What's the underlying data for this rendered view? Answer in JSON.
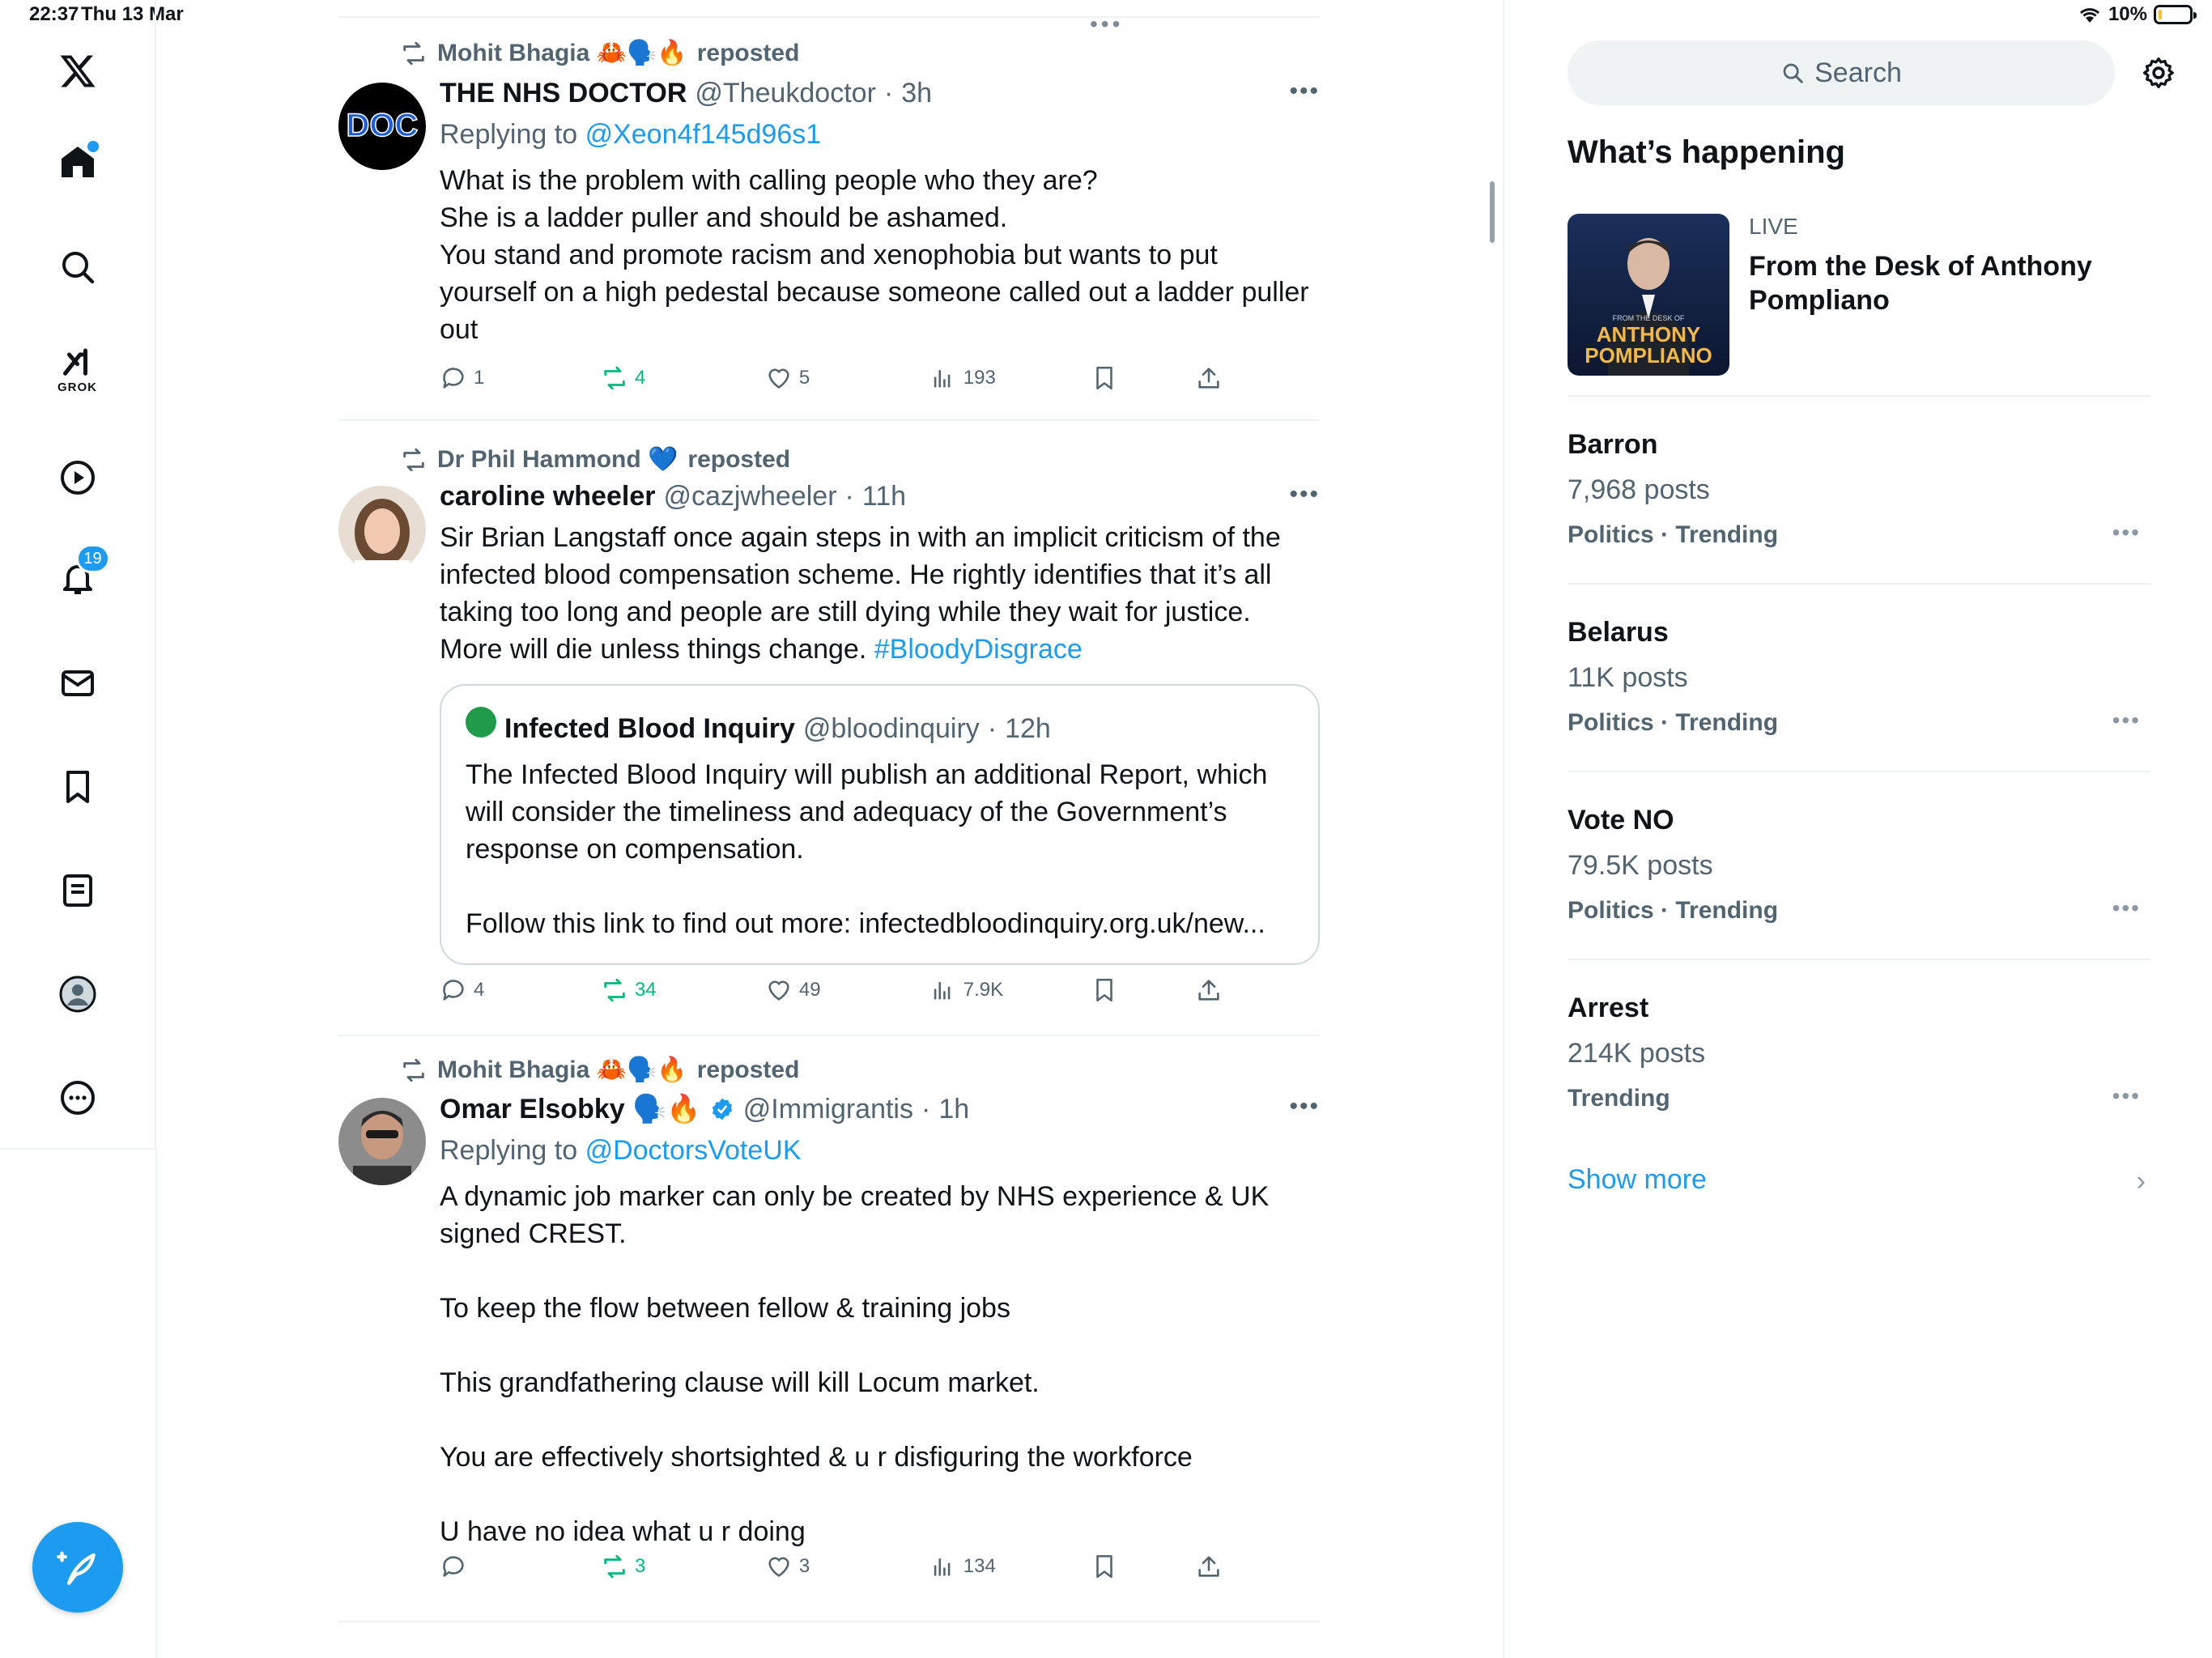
{
  "status_bar": {
    "time": "22:37",
    "date": "Thu 13 Mar",
    "battery": "10%",
    "battery_level": 0.1
  },
  "nav": {
    "grok_label": "GROK",
    "notifications_badge": "19",
    "items": [
      "home",
      "explore",
      "grok",
      "video",
      "notifications",
      "messages",
      "bookmarks",
      "lists",
      "profile",
      "more"
    ]
  },
  "tweets": [
    {
      "reposter": "Mohit Bhagia 🦀🗣️🔥",
      "repost_suffix": "reposted",
      "name": "THE NHS DOCTOR",
      "handle": "@Theukdoctor",
      "time": "3h",
      "replying_prefix": "Replying to",
      "replying_to": "@Xeon4f145d96s1",
      "text": "What is the problem with calling people who they are?\nShe is a ladder puller and should be ashamed.\nYou stand and promote racism and xenophobia but wants to put yourself on a high pedestal because someone called out a ladder puller out",
      "replies": "1",
      "reposts": "4",
      "likes": "5",
      "views": "193"
    },
    {
      "reposter": "Dr Phil Hammond 💙",
      "repost_suffix": "reposted",
      "name": "caroline wheeler",
      "handle": "@cazjwheeler",
      "time": "11h",
      "text": "Sir Brian Langstaff once again steps in with an implicit criticism of the infected blood compensation scheme. He rightly identifies that it’s all taking too long and people are still dying while they wait for justice. More will die unless things change.",
      "hashtag": "#BloodyDisgrace",
      "quote": {
        "name": "Infected Blood Inquiry",
        "handle": "@bloodinquiry",
        "time": "12h",
        "text": "The Infected Blood Inquiry will publish an additional Report, which will consider the timeliness and adequacy of the Government’s response on compensation.\n\nFollow this link to find out more: infectedbloodinquiry.org.uk/new..."
      },
      "replies": "4",
      "reposts": "34",
      "likes": "49",
      "views": "7.9K"
    },
    {
      "reposter": "Mohit Bhagia 🦀🗣️🔥",
      "repost_suffix": "reposted",
      "name": "Omar Elsobky 🗣️🔥",
      "handle": "@Immigrantis",
      "time": "1h",
      "replying_prefix": "Replying to",
      "replying_to": "@DoctorsVoteUK",
      "text": "A dynamic job marker can only be created by NHS experience & UK signed CREST.\n\nTo keep the flow between fellow & training jobs\n\nThis grandfathering clause will kill Locum market.\n\nYou are effectively shortsighted & u r disfiguring the workforce\n\nU have no idea what u r doing",
      "replies": "",
      "reposts": "3",
      "likes": "3",
      "views": "134"
    }
  ],
  "sidebar": {
    "search_placeholder": "Search",
    "section_title": "What’s happening",
    "live": {
      "label": "LIVE",
      "title": "From the Desk of Anthony Pompliano",
      "thumb_top": "FROM THE DESK OF",
      "thumb_name1": "ANTHONY",
      "thumb_name2": "POMPLIANO"
    },
    "trends": [
      {
        "name": "Barron",
        "count": "7,968 posts",
        "category": "Politics · Trending"
      },
      {
        "name": "Belarus",
        "count": "11K posts",
        "category": "Politics · Trending"
      },
      {
        "name": "Vote NO",
        "count": "79.5K posts",
        "category": "Politics · Trending"
      },
      {
        "name": "Arrest",
        "count": "214K posts",
        "category": "Trending"
      }
    ],
    "show_more": "Show more"
  },
  "colors": {
    "accent": "#1d9bf0",
    "repost_green": "#00ba7c",
    "muted": "#536471"
  }
}
